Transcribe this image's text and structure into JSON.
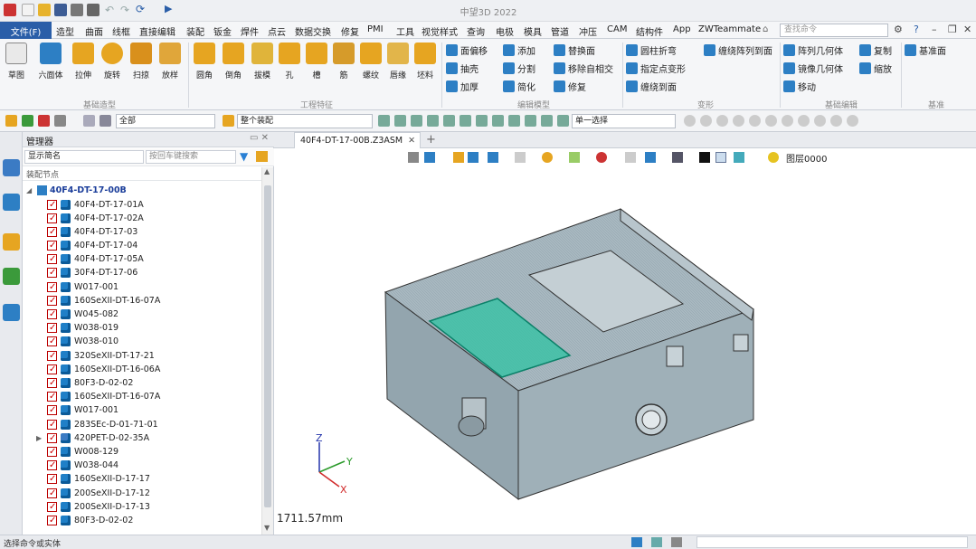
{
  "app": {
    "title": "中望3D 2022"
  },
  "menu": {
    "file": "文件(F)",
    "items": [
      "造型",
      "曲面",
      "线框",
      "直接编辑",
      "装配",
      "钣金",
      "焊件",
      "点云",
      "数据交换",
      "修复",
      "PMI",
      "工具",
      "视觉样式",
      "查询",
      "电极",
      "模具",
      "管道",
      "冲压",
      "CAM",
      "结构件",
      "App",
      "ZWTeammate"
    ],
    "search_placeholder": "查找命令"
  },
  "ribbon": {
    "big": [
      "草图",
      "六面体",
      "拉伸",
      "旋转",
      "扫掠",
      "放样",
      "圆角",
      "倒角",
      "拔模",
      "孔",
      "槽",
      "筋",
      "螺纹",
      "唇缘",
      "坯料"
    ],
    "small1": [
      "面偏移",
      "抽壳",
      "加厚"
    ],
    "small2": [
      "添加",
      "分割",
      "简化"
    ],
    "small3": [
      "替换面",
      "移除自相交",
      "修复"
    ],
    "small4": [
      "圆柱折弯",
      "指定点变形",
      "缠绕到面"
    ],
    "small5": [
      "缠绕阵列到面"
    ],
    "small6": [
      "阵列几何体",
      "镜像几何体",
      "移动"
    ],
    "small7": [
      "复制",
      "缩放"
    ],
    "small8": [
      "基准面"
    ],
    "groups": [
      "基础造型",
      "工程特征",
      "编辑模型",
      "变形",
      "基础编辑",
      "基准"
    ]
  },
  "toolbar": {
    "filter_all": "全部",
    "assembly": "整个装配",
    "select_mode": "单一选择"
  },
  "panel": {
    "title": "管理器",
    "display_name": "显示简名",
    "search_placeholder": "按回车键搜索",
    "col_header": "装配节点",
    "root": "40F4-DT-17-00B",
    "rows": [
      "40F4-DT-17-01A",
      "40F4-DT-17-02A",
      "40F4-DT-17-03",
      "40F4-DT-17-04",
      "40F4-DT-17-05A",
      "30F4-DT-17-06",
      "W017-001",
      "160SeXII-DT-16-07A",
      "W045-082",
      "W038-019",
      "W038-010",
      "320SeXII-DT-17-21",
      "160SeXII-DT-16-06A",
      "80F3-D-02-02",
      "160SeXII-DT-16-07A",
      "W017-001",
      "283SEc-D-01-71-01",
      "420PET-D-02-35A",
      "W008-129",
      "W038-044",
      "160SeXII-D-17-17",
      "200SeXII-D-17-12",
      "200SeXII-D-17-13",
      "80F3-D-02-02"
    ]
  },
  "doc": {
    "tab": "40F4-DT-17-00B.Z3ASM",
    "layer": "图层0000"
  },
  "viewport": {
    "measure": "1711.57mm",
    "axes": {
      "x": "X",
      "y": "Y",
      "z": "Z"
    }
  },
  "status": {
    "hint": "选择命令或实体"
  },
  "colors": {
    "accent": "#2a5ea8",
    "part": "#9fb0b8",
    "glass": "#2fc3a3"
  }
}
